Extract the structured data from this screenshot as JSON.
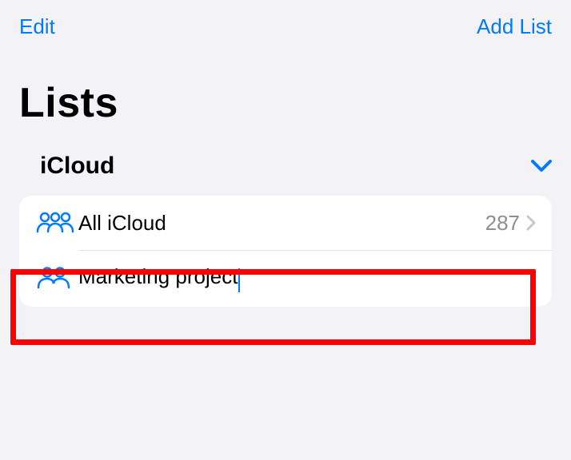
{
  "header": {
    "edit_label": "Edit",
    "add_list_label": "Add List"
  },
  "page_title": "Lists",
  "section": {
    "title": "iCloud"
  },
  "rows": [
    {
      "icon": "people-3-icon",
      "label": "All iCloud",
      "count": "287",
      "has_chevron": true
    },
    {
      "icon": "people-2-icon",
      "label": "Marketing project",
      "editing": true
    }
  ]
}
